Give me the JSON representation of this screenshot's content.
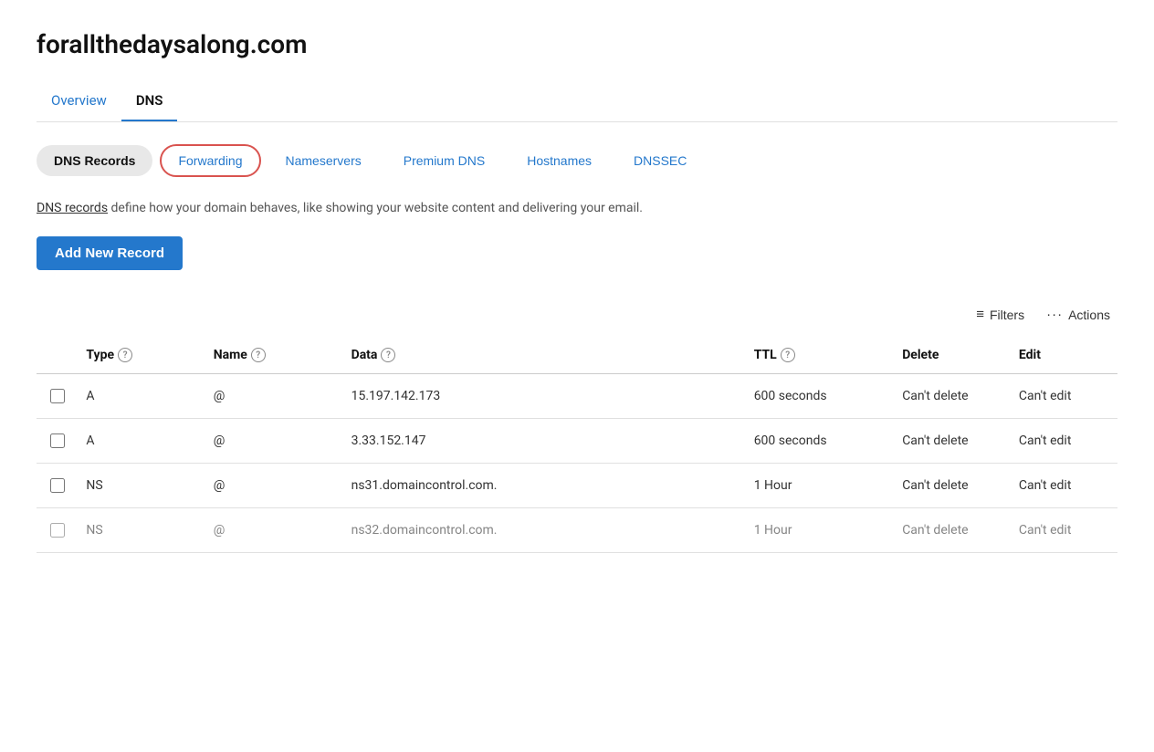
{
  "domain": {
    "title": "forallthedaysalong.com"
  },
  "tabs": [
    {
      "id": "overview",
      "label": "Overview",
      "active": false
    },
    {
      "id": "dns",
      "label": "DNS",
      "active": true
    }
  ],
  "sub_tabs": [
    {
      "id": "dns-records",
      "label": "DNS Records",
      "state": "active"
    },
    {
      "id": "forwarding",
      "label": "Forwarding",
      "state": "highlighted"
    },
    {
      "id": "nameservers",
      "label": "Nameservers",
      "state": "normal"
    },
    {
      "id": "premium-dns",
      "label": "Premium DNS",
      "state": "normal"
    },
    {
      "id": "hostnames",
      "label": "Hostnames",
      "state": "normal"
    },
    {
      "id": "dnssec",
      "label": "DNSSEC",
      "state": "normal"
    }
  ],
  "description": {
    "link_text": "DNS records",
    "text": " define how your domain behaves, like showing your website content and delivering your email."
  },
  "add_button": "Add New Record",
  "table_controls": {
    "filters_label": "Filters",
    "actions_label": "Actions"
  },
  "table": {
    "columns": [
      {
        "id": "checkbox",
        "label": ""
      },
      {
        "id": "type",
        "label": "Type",
        "has_help": true
      },
      {
        "id": "name",
        "label": "Name",
        "has_help": true
      },
      {
        "id": "data",
        "label": "Data",
        "has_help": true
      },
      {
        "id": "ttl",
        "label": "TTL",
        "has_help": true
      },
      {
        "id": "delete",
        "label": "Delete",
        "has_help": false
      },
      {
        "id": "edit",
        "label": "Edit",
        "has_help": false
      }
    ],
    "rows": [
      {
        "type": "A",
        "name": "@",
        "data": "15.197.142.173",
        "ttl": "600 seconds",
        "delete": "Can't delete",
        "edit": "Can't edit"
      },
      {
        "type": "A",
        "name": "@",
        "data": "3.33.152.147",
        "ttl": "600 seconds",
        "delete": "Can't delete",
        "edit": "Can't edit"
      },
      {
        "type": "NS",
        "name": "@",
        "data": "ns31.domaincontrol.com.",
        "ttl": "1 Hour",
        "delete": "Can't delete",
        "edit": "Can't edit"
      },
      {
        "type": "NS",
        "name": "@",
        "data": "ns32.domaincontrol.com.",
        "ttl": "1 Hour",
        "delete": "Can't delete",
        "edit": "Can't edit",
        "partial": true
      }
    ]
  }
}
